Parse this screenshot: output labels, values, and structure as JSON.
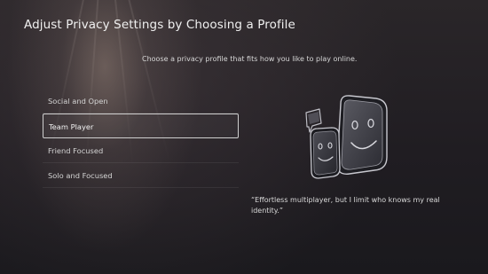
{
  "header": {
    "title": "Adjust Privacy Settings by Choosing a Profile",
    "subtitle": "Choose a privacy profile that fits how you like to play online."
  },
  "profiles": {
    "selected_index": 1,
    "items": [
      {
        "label": "Social and Open"
      },
      {
        "label": "Team Player"
      },
      {
        "label": "Friend Focused"
      },
      {
        "label": "Solo and Focused"
      }
    ]
  },
  "detail": {
    "illustration_icon": "two-faces-chat-icon",
    "description": "“Effortless multiplayer, but I limit who knows my real identity.”"
  },
  "theme": {
    "background": "#1c1a1f",
    "selection_border": "#cfcfcf"
  }
}
